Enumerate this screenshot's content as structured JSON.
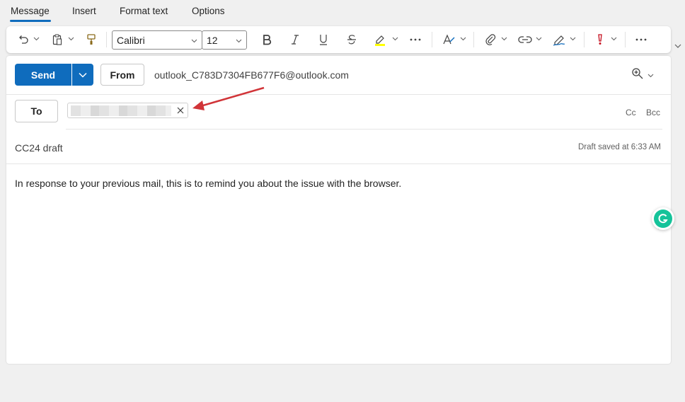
{
  "tabs": [
    {
      "label": "Message",
      "active": true
    },
    {
      "label": "Insert",
      "active": false
    },
    {
      "label": "Format text",
      "active": false
    },
    {
      "label": "Options",
      "active": false
    }
  ],
  "ribbon": {
    "font_name": "Calibri",
    "font_size": "12",
    "icons": [
      "undo-icon",
      "clipboard-icon",
      "format-painter-icon",
      "bold-icon",
      "italic-icon",
      "underline-icon",
      "strikethrough-icon",
      "highlight-icon",
      "more-icon",
      "styles-icon",
      "attach-icon",
      "link-icon",
      "signature-icon",
      "importance-icon",
      "overflow-icon"
    ],
    "highlight_color": "#ffff00",
    "importance_color": "#c50f1f"
  },
  "compose": {
    "send_label": "Send",
    "from_label": "From",
    "from_address": "outlook_C783D7304FB677F6@outlook.com",
    "to_label": "To",
    "cc_label": "Cc",
    "bcc_label": "Bcc",
    "subject": "CC24 draft",
    "draft_status": "Draft saved at 6:33 AM",
    "body": "In response to your previous mail, this is to remind you about the issue with the browser."
  },
  "colors": {
    "accent": "#0f6cbd",
    "annotation_arrow": "#d13438",
    "grammarly": "#15c39a"
  }
}
